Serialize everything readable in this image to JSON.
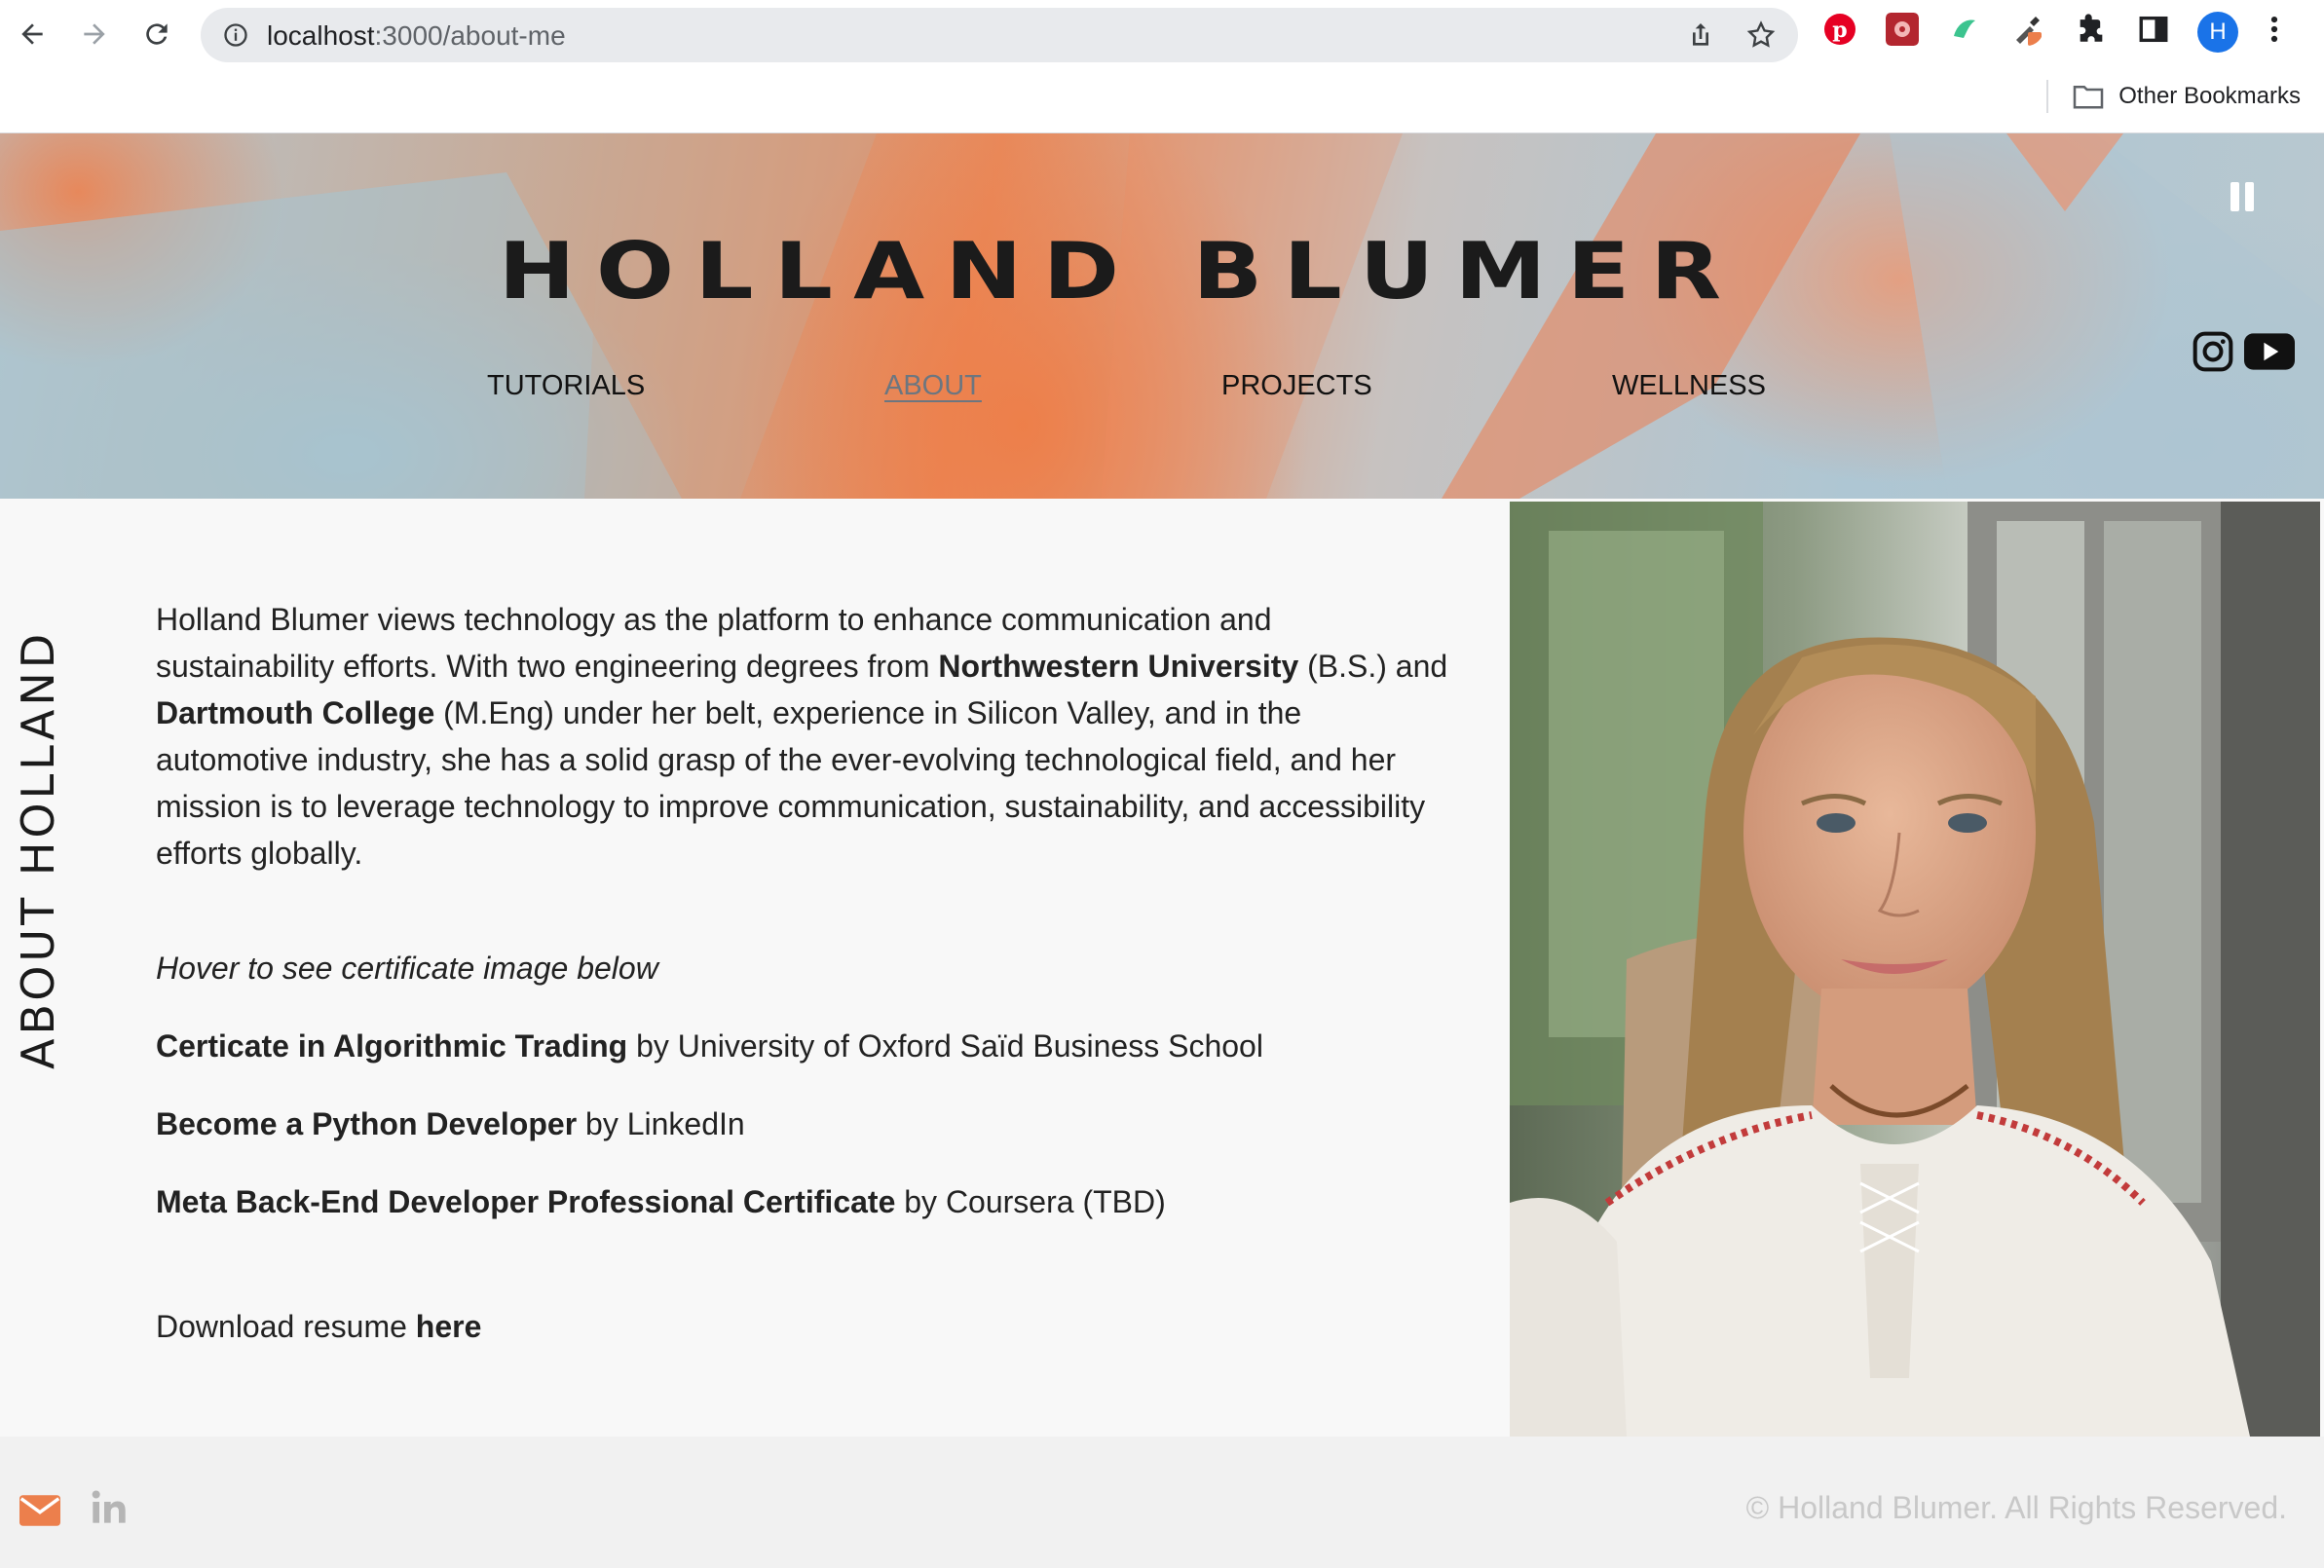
{
  "browser": {
    "url_host": "localhost",
    "url_path": ":3000/about-me",
    "bookmark_folder": "Other Bookmarks",
    "profile_initial": "H"
  },
  "site": {
    "title": "HOLLAND BLUMER",
    "nav": [
      "TUTORIALS",
      "ABOUT",
      "PROJECTS",
      "WELLNESS"
    ],
    "active_nav": "ABOUT"
  },
  "about": {
    "vertical_title": "ABOUT HOLLAND",
    "bio_1": "Holland Blumer views technology as the platform to enhance communication and sustainability efforts. With two engineering degrees from ",
    "school_1": "Northwestern University",
    "bio_2": " (B.S.) and ",
    "school_2": "Dartmouth College",
    "bio_3": " (M.Eng) under her belt, experience in Silicon Valley, and in the automotive industry, she has a solid grasp of the ever-evolving technological field, and her mission is to leverage technology to improve communication, sustainability, and accessibility efforts globally.",
    "hover_hint": "Hover to see certificate image below",
    "certificates": [
      {
        "name": "Certicate in Algorithmic Trading",
        "by": " by University of Oxford Saïd Business School"
      },
      {
        "name": "Become a Python Developer",
        "by": " by LinkedIn"
      },
      {
        "name": "Meta Back-End Developer Professional Certificate",
        "by": " by Coursera (TBD)"
      }
    ],
    "resume_text": "Download resume ",
    "resume_link": "here"
  },
  "footer": {
    "copyright": "© Holland Blumer. All Rights Reserved."
  },
  "colors": {
    "accent_orange": "#ec7f4c",
    "hero_blue": "#aec6d3"
  }
}
